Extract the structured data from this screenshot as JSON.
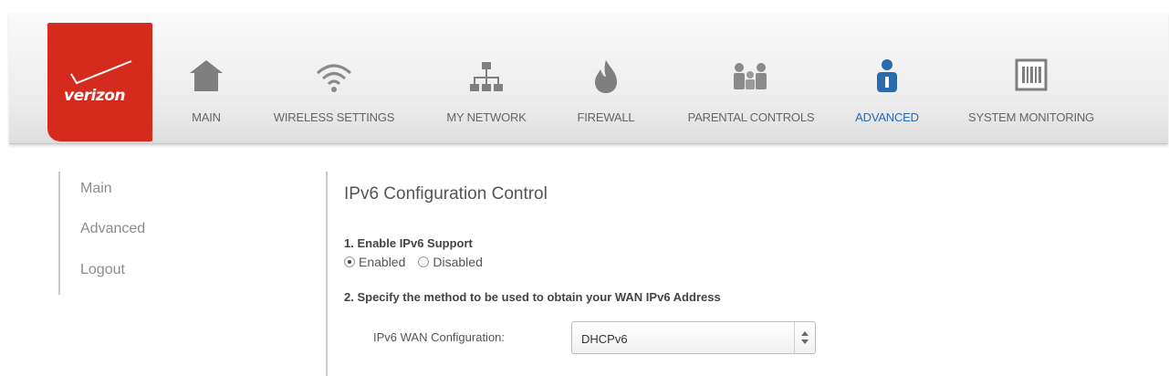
{
  "brand": {
    "name": "verizon",
    "color": "#d52b1e"
  },
  "nav": {
    "active_color": "#2a6bb0",
    "items": [
      {
        "label": "MAIN",
        "icon": "home-icon"
      },
      {
        "label": "WIRELESS SETTINGS",
        "icon": "wifi-icon"
      },
      {
        "label": "MY NETWORK",
        "icon": "network-icon"
      },
      {
        "label": "FIREWALL",
        "icon": "flame-icon"
      },
      {
        "label": "PARENTAL CONTROLS",
        "icon": "family-icon"
      },
      {
        "label": "ADVANCED",
        "icon": "advanced-user-icon",
        "active": true
      },
      {
        "label": "SYSTEM MONITORING",
        "icon": "monitor-icon"
      }
    ]
  },
  "sidebar": {
    "items": [
      {
        "label": "Main"
      },
      {
        "label": "Advanced"
      },
      {
        "label": "Logout"
      }
    ]
  },
  "content": {
    "title": "IPv6 Configuration Control",
    "section1": "1. Enable IPv6 Support",
    "radio_enabled": "Enabled",
    "radio_disabled": "Disabled",
    "ipv6_support_selected": "Enabled",
    "section2": "2. Specify the method to be used to obtain your WAN IPv6 Address",
    "wan_label": "IPv6 WAN Configuration:",
    "wan_value": "DHCPv6"
  }
}
